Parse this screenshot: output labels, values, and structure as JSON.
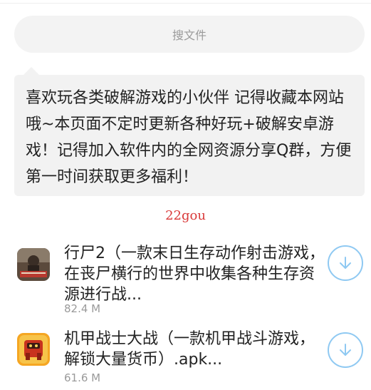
{
  "search": {
    "placeholder": "搜文件"
  },
  "notice": {
    "text": "喜欢玩各类破解游戏的小伙伴 记得收藏本网站哦~本页面不定时更新各种好玩+破解安卓游戏！记得加入软件内的全网资源分享Q群，方便第一时间获取更多福利！"
  },
  "source": {
    "label": "22gou"
  },
  "files": [
    {
      "title": "行尸2（一款末日生存动作射击游戏，在丧尸横行的世界中收集各种生存资源进行战...",
      "size": "82.4 M",
      "icon": "zombie-game-icon"
    },
    {
      "title": "机甲战士大战（一款机甲战斗游戏，解锁大量货币）.apk...",
      "size": "61.6 M",
      "icon": "mech-game-icon"
    }
  ],
  "colors": {
    "accent": "#8fc9f2",
    "link": "#d93a3a",
    "muted": "#9a9a9a",
    "panel": "#f2f2f2"
  }
}
